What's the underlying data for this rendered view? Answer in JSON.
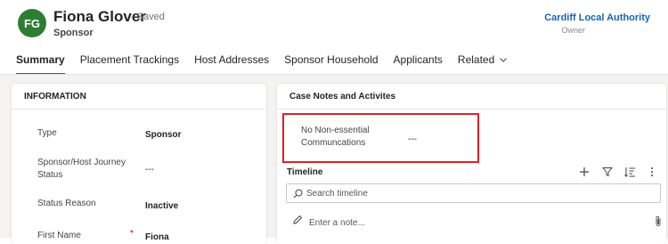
{
  "header": {
    "avatar_initials": "FG",
    "avatar_color": "#2f7d32",
    "record_name": "Fiona Glover",
    "save_status": "- Saved",
    "record_type": "Sponsor",
    "owner_name": "Cardiff Local Authority",
    "owner_label": "Owner"
  },
  "tabs": [
    {
      "label": "Summary",
      "active": true
    },
    {
      "label": "Placement Trackings"
    },
    {
      "label": "Host Addresses"
    },
    {
      "label": "Sponsor Household"
    },
    {
      "label": "Applicants"
    },
    {
      "label": "Related"
    }
  ],
  "information": {
    "title": "INFORMATION",
    "fields": [
      {
        "label": "Type",
        "value": "Sponsor"
      },
      {
        "label": "Sponsor/Host Journey Status",
        "value": "---"
      },
      {
        "label": "Status Reason",
        "value": "Inactive"
      },
      {
        "label": "First Name",
        "required_marker": "*",
        "value": "Fiona"
      }
    ]
  },
  "case_notes": {
    "title": "Case Notes and Activites",
    "field_label": "No Non-essential Communcations",
    "field_value": "---"
  },
  "timeline": {
    "title": "Timeline",
    "search_placeholder": "Search timeline",
    "note_placeholder": "Enter a note..."
  },
  "colors": {
    "accent": "#1763b8",
    "highlight_box": "#e0202a"
  }
}
